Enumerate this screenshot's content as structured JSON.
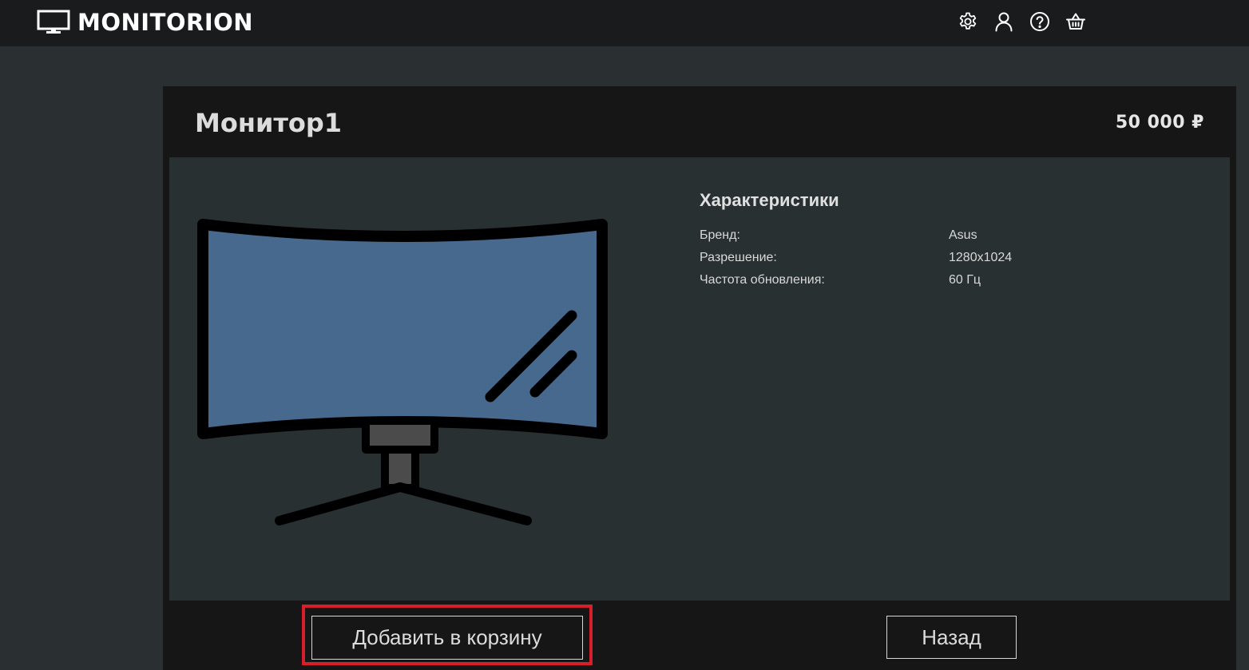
{
  "header": {
    "brand": "MONITORION",
    "logo_icon": "monitor-icon",
    "nav_icons": [
      "settings-icon",
      "user-icon",
      "help-icon",
      "basket-icon"
    ]
  },
  "product": {
    "title": "Монитор1",
    "price": "50 000 ₽",
    "image_icon": "curved-monitor-illustration",
    "specs_title": "Характеристики",
    "specs": [
      {
        "label": "Бренд:",
        "value": "Asus"
      },
      {
        "label": "Разрешение:",
        "value": "1280x1024"
      },
      {
        "label": "Частота обновления:",
        "value": "60 Гц"
      }
    ]
  },
  "actions": {
    "add_to_cart": "Добавить в корзину",
    "back": "Назад"
  },
  "colors": {
    "page_bg": "#2a3032",
    "topbar_bg": "#1a1b1c",
    "card_bg": "#161616",
    "panel_bg": "#293032",
    "screen_fill": "#47698d",
    "highlight": "#d71e2b"
  }
}
